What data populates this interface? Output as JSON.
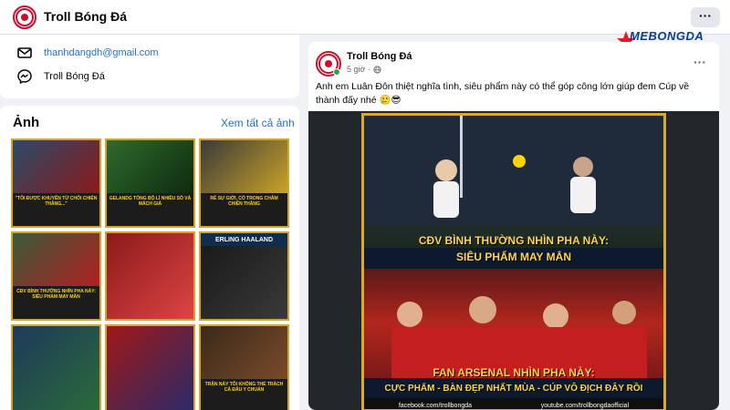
{
  "topbar": {
    "page_title": "Troll Bóng Đá",
    "more_icon": "ellipsis-icon"
  },
  "watermark": {
    "text": "MEBONGDA"
  },
  "contact": {
    "email": "thanhdangdh@gmail.com",
    "messenger": "Troll Bóng Đá"
  },
  "photos": {
    "title": "Ảnh",
    "see_all": "Xem tất cả ảnh",
    "thumbs": [
      {
        "caption": "\"TÔI ĐƯỢC KHUYÊN TỪ CHỐI CHIẾN THẮNG...\"",
        "name": ""
      },
      {
        "caption": "GELANDG TÒNG BỘ LÍ NHIỀU SỐ VÀ MÁCH GIẢ",
        "name": ""
      },
      {
        "caption": "RẺ SỰ GIỚI, CÓ TRONG CHÂM CHIẾN THẮNG",
        "name": ""
      },
      {
        "caption": "CĐV BÌNH THƯỜNG NHÌN PHA NÀY: SIÊU PHẨM MAY MẮN",
        "name": ""
      },
      {
        "caption": "",
        "name": ""
      },
      {
        "caption": "",
        "name": "ERLING HAALAND"
      },
      {
        "caption": "",
        "name": ""
      },
      {
        "caption": "",
        "name": ""
      },
      {
        "caption": "TRẬN NÀY TÔI KHÔNG THỂ TRÁCH CÁ ĐẤU Y CHUẨN",
        "name": ""
      }
    ]
  },
  "post": {
    "author": "Troll Bóng Đá",
    "time": "5 giờ ·",
    "text": "Anh em Luân Đôn thiệt nghĩa tình, siêu phẩm này có thể góp công lớn giúp đem Cúp về thành đấy nhé 🥲😎",
    "meme": {
      "top_caption_1": "CĐV BÌNH THƯỜNG NHÌN PHA NÀY:",
      "top_caption_2": "SIÊU PHẨM MAY MẮN",
      "bottom_caption_1": "FAN ARSENAL NHÌN PHA NÀY:",
      "bottom_caption_2": "CỰC PHẨM - BÀN ĐẸP NHẤT MÙA - CÚP VÔ ĐỊCH ĐÂY RỒI",
      "footer_fb": "facebook.com/trollbongda",
      "footer_yt": "youtube.com/trollbongdaofficial"
    }
  },
  "colors": {
    "brand": "#c8102e",
    "link": "#216fdb",
    "meme_gold": "#d8ab2d",
    "caption_yellow": "#ffd54a"
  }
}
